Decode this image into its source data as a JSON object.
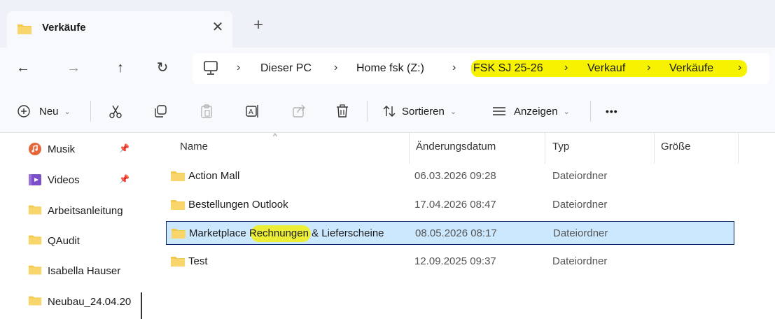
{
  "tab": {
    "title": "Verkäufe",
    "close_glyph": "✕",
    "new_tab_glyph": "+"
  },
  "nav": {
    "back_glyph": "←",
    "forward_glyph": "→",
    "up_glyph": "↑",
    "refresh_glyph": "↻",
    "separator_glyph": "›",
    "breadcrumbs": [
      "Dieser PC",
      "Home fsk (Z:)",
      "FSK SJ 25-26",
      "Verkauf",
      "Verkäufe"
    ],
    "highlight_color": "#f6f200"
  },
  "toolbar": {
    "new_label": "Neu",
    "sort_label": "Sortieren",
    "view_label": "Anzeigen",
    "more_glyph": "•••",
    "chevron_glyph": "⌄"
  },
  "sidebar": {
    "pin_glyph": "📌",
    "items": [
      {
        "label": "Musik",
        "icon": "music-icon",
        "pinned": true
      },
      {
        "label": "Videos",
        "icon": "videos-icon",
        "pinned": true
      },
      {
        "label": "Arbeitsanleitung",
        "icon": "folder-icon",
        "pinned": false
      },
      {
        "label": "QAudit",
        "icon": "folder-icon",
        "pinned": false
      },
      {
        "label": "Isabella Hauser",
        "icon": "folder-icon",
        "pinned": false
      },
      {
        "label": "Neubau_24.04.20",
        "icon": "folder-icon",
        "pinned": false
      }
    ]
  },
  "list": {
    "columns": {
      "name": "Name",
      "date": "Änderungsdatum",
      "type": "Typ",
      "size": "Größe"
    },
    "sort_caret": "^",
    "rows": [
      {
        "name": "Action Mall",
        "date": "06.03.2026 09:28",
        "type": "Dateiordner",
        "size": ""
      },
      {
        "name": "Bestellungen Outlook",
        "date": "17.04.2026 08:47",
        "type": "Dateiordner",
        "size": ""
      },
      {
        "name": "Marketplace Rechnungen & Lieferscheine",
        "date": "08.05.2026 08:17",
        "type": "Dateiordner",
        "size": "",
        "selected": true
      },
      {
        "name": "Test",
        "date": "12.09.2025 09:37",
        "type": "Dateiordner",
        "size": ""
      }
    ],
    "selection_color": "#cce8ff",
    "folder_color": "#f2c94c"
  }
}
